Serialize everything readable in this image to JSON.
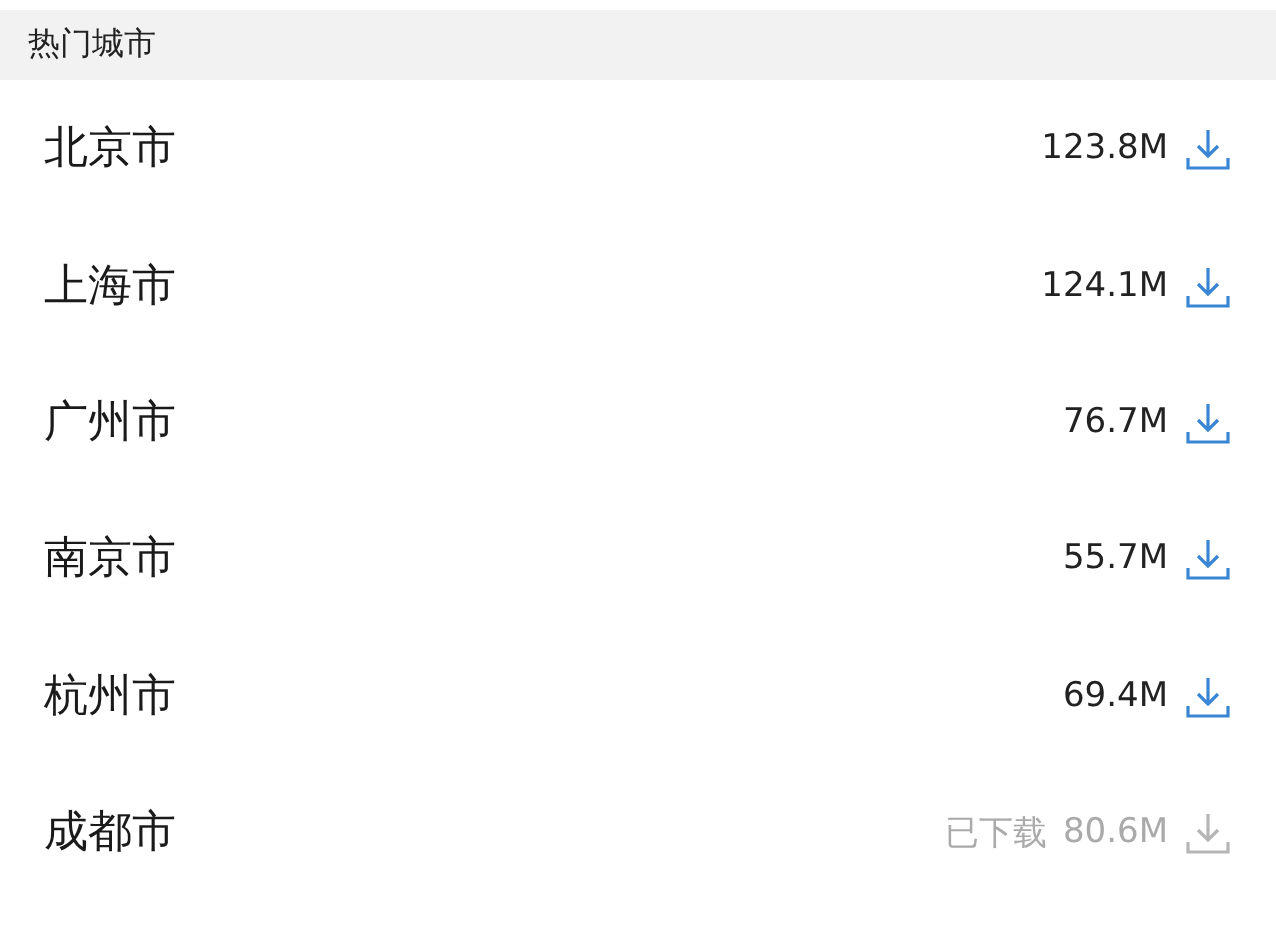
{
  "section": {
    "title": "热门城市"
  },
  "cities": [
    {
      "name": "北京市",
      "size": "123.8M",
      "downloaded": false
    },
    {
      "name": "上海市",
      "size": "124.1M",
      "downloaded": false
    },
    {
      "name": "广州市",
      "size": "76.7M",
      "downloaded": false
    },
    {
      "name": "南京市",
      "size": "55.7M",
      "downloaded": false
    },
    {
      "name": "杭州市",
      "size": "69.4M",
      "downloaded": false
    },
    {
      "name": "成都市",
      "size": "80.6M",
      "downloaded": true,
      "status": "已下载"
    }
  ]
}
